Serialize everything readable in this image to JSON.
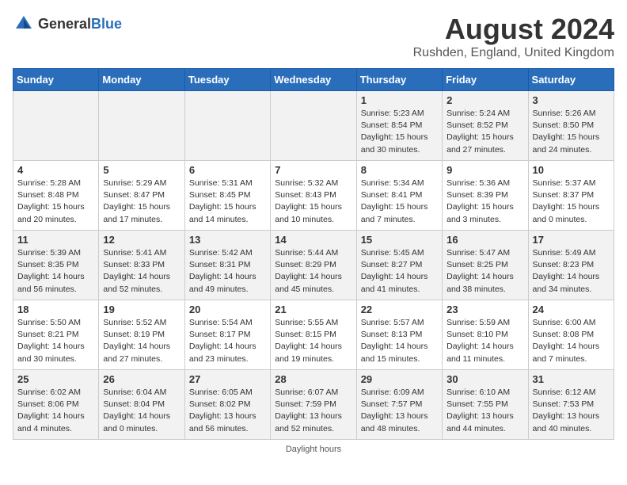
{
  "header": {
    "logo_general": "General",
    "logo_blue": "Blue",
    "month_title": "August 2024",
    "location": "Rushden, England, United Kingdom"
  },
  "days_of_week": [
    "Sunday",
    "Monday",
    "Tuesday",
    "Wednesday",
    "Thursday",
    "Friday",
    "Saturday"
  ],
  "weeks": [
    [
      {
        "day": "",
        "info": ""
      },
      {
        "day": "",
        "info": ""
      },
      {
        "day": "",
        "info": ""
      },
      {
        "day": "",
        "info": ""
      },
      {
        "day": "1",
        "info": "Sunrise: 5:23 AM\nSunset: 8:54 PM\nDaylight: 15 hours and 30 minutes."
      },
      {
        "day": "2",
        "info": "Sunrise: 5:24 AM\nSunset: 8:52 PM\nDaylight: 15 hours and 27 minutes."
      },
      {
        "day": "3",
        "info": "Sunrise: 5:26 AM\nSunset: 8:50 PM\nDaylight: 15 hours and 24 minutes."
      }
    ],
    [
      {
        "day": "4",
        "info": "Sunrise: 5:28 AM\nSunset: 8:48 PM\nDaylight: 15 hours and 20 minutes."
      },
      {
        "day": "5",
        "info": "Sunrise: 5:29 AM\nSunset: 8:47 PM\nDaylight: 15 hours and 17 minutes."
      },
      {
        "day": "6",
        "info": "Sunrise: 5:31 AM\nSunset: 8:45 PM\nDaylight: 15 hours and 14 minutes."
      },
      {
        "day": "7",
        "info": "Sunrise: 5:32 AM\nSunset: 8:43 PM\nDaylight: 15 hours and 10 minutes."
      },
      {
        "day": "8",
        "info": "Sunrise: 5:34 AM\nSunset: 8:41 PM\nDaylight: 15 hours and 7 minutes."
      },
      {
        "day": "9",
        "info": "Sunrise: 5:36 AM\nSunset: 8:39 PM\nDaylight: 15 hours and 3 minutes."
      },
      {
        "day": "10",
        "info": "Sunrise: 5:37 AM\nSunset: 8:37 PM\nDaylight: 15 hours and 0 minutes."
      }
    ],
    [
      {
        "day": "11",
        "info": "Sunrise: 5:39 AM\nSunset: 8:35 PM\nDaylight: 14 hours and 56 minutes."
      },
      {
        "day": "12",
        "info": "Sunrise: 5:41 AM\nSunset: 8:33 PM\nDaylight: 14 hours and 52 minutes."
      },
      {
        "day": "13",
        "info": "Sunrise: 5:42 AM\nSunset: 8:31 PM\nDaylight: 14 hours and 49 minutes."
      },
      {
        "day": "14",
        "info": "Sunrise: 5:44 AM\nSunset: 8:29 PM\nDaylight: 14 hours and 45 minutes."
      },
      {
        "day": "15",
        "info": "Sunrise: 5:45 AM\nSunset: 8:27 PM\nDaylight: 14 hours and 41 minutes."
      },
      {
        "day": "16",
        "info": "Sunrise: 5:47 AM\nSunset: 8:25 PM\nDaylight: 14 hours and 38 minutes."
      },
      {
        "day": "17",
        "info": "Sunrise: 5:49 AM\nSunset: 8:23 PM\nDaylight: 14 hours and 34 minutes."
      }
    ],
    [
      {
        "day": "18",
        "info": "Sunrise: 5:50 AM\nSunset: 8:21 PM\nDaylight: 14 hours and 30 minutes."
      },
      {
        "day": "19",
        "info": "Sunrise: 5:52 AM\nSunset: 8:19 PM\nDaylight: 14 hours and 27 minutes."
      },
      {
        "day": "20",
        "info": "Sunrise: 5:54 AM\nSunset: 8:17 PM\nDaylight: 14 hours and 23 minutes."
      },
      {
        "day": "21",
        "info": "Sunrise: 5:55 AM\nSunset: 8:15 PM\nDaylight: 14 hours and 19 minutes."
      },
      {
        "day": "22",
        "info": "Sunrise: 5:57 AM\nSunset: 8:13 PM\nDaylight: 14 hours and 15 minutes."
      },
      {
        "day": "23",
        "info": "Sunrise: 5:59 AM\nSunset: 8:10 PM\nDaylight: 14 hours and 11 minutes."
      },
      {
        "day": "24",
        "info": "Sunrise: 6:00 AM\nSunset: 8:08 PM\nDaylight: 14 hours and 7 minutes."
      }
    ],
    [
      {
        "day": "25",
        "info": "Sunrise: 6:02 AM\nSunset: 8:06 PM\nDaylight: 14 hours and 4 minutes."
      },
      {
        "day": "26",
        "info": "Sunrise: 6:04 AM\nSunset: 8:04 PM\nDaylight: 14 hours and 0 minutes."
      },
      {
        "day": "27",
        "info": "Sunrise: 6:05 AM\nSunset: 8:02 PM\nDaylight: 13 hours and 56 minutes."
      },
      {
        "day": "28",
        "info": "Sunrise: 6:07 AM\nSunset: 7:59 PM\nDaylight: 13 hours and 52 minutes."
      },
      {
        "day": "29",
        "info": "Sunrise: 6:09 AM\nSunset: 7:57 PM\nDaylight: 13 hours and 48 minutes."
      },
      {
        "day": "30",
        "info": "Sunrise: 6:10 AM\nSunset: 7:55 PM\nDaylight: 13 hours and 44 minutes."
      },
      {
        "day": "31",
        "info": "Sunrise: 6:12 AM\nSunset: 7:53 PM\nDaylight: 13 hours and 40 minutes."
      }
    ]
  ],
  "footer": {
    "note": "Daylight hours"
  }
}
